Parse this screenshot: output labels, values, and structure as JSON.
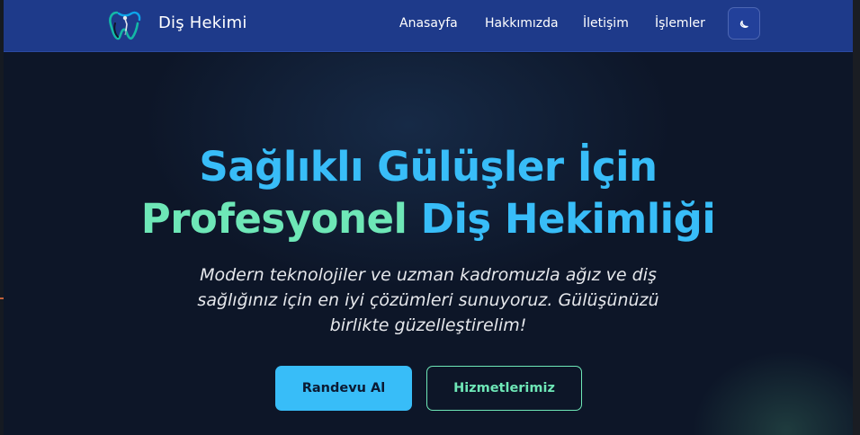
{
  "header": {
    "brand": "Diş Hekimi",
    "nav": [
      {
        "label": "Anasayfa"
      },
      {
        "label": "Hakkımızda"
      },
      {
        "label": "İletişim"
      },
      {
        "label": "İşlemler"
      }
    ],
    "theme_toggle_icon": "moon-icon"
  },
  "hero": {
    "title_line1": "Sağlıklı Gülüşler İçin",
    "title_line2_highlight": "Profesyonel",
    "title_line2_rest": " Diş Hekimliği",
    "subtitle": "Modern teknolojiler ve uzman kadromuzla ağız ve diş sağlığınız için en iyi çözümleri sunuyoruz. Gülüşünüzü birlikte güzelleştirelim!",
    "primary_button": "Randevu Al",
    "secondary_button": "Hizmetlerimiz"
  },
  "colors": {
    "header_bg": "#1e3a8a",
    "accent_blue": "#38bdf8",
    "accent_green": "#6ee7b7",
    "page_bg": "#0d1628"
  }
}
